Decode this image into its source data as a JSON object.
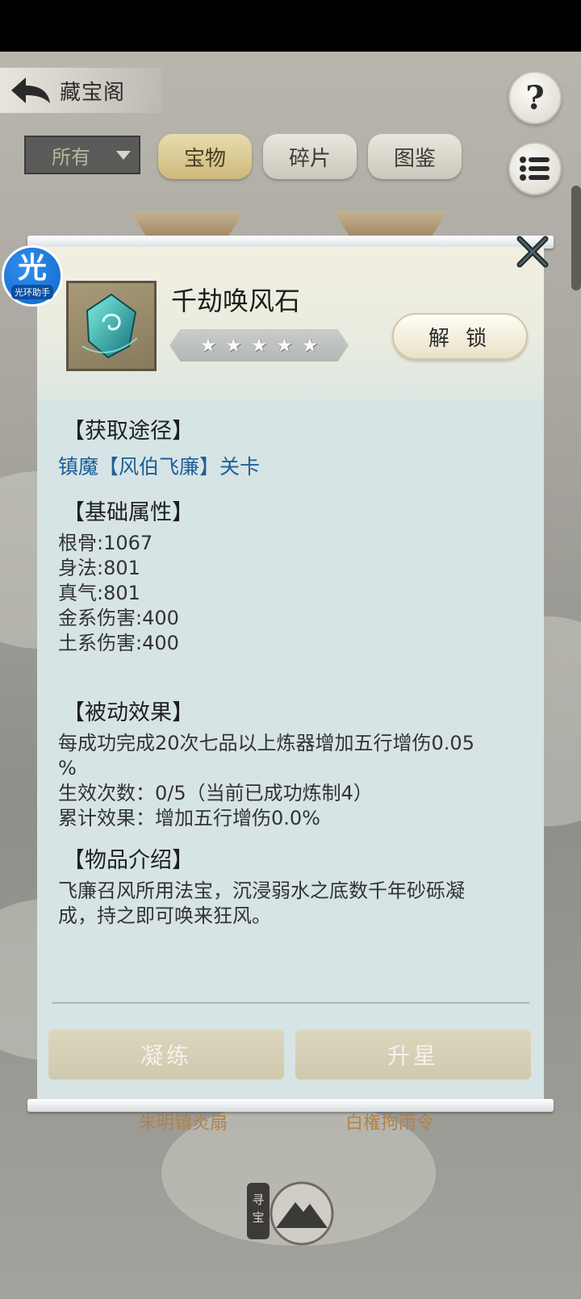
{
  "header": {
    "title": "藏宝阁",
    "help_label": "?"
  },
  "filter": {
    "selected": "所有",
    "tabs": [
      "宝物",
      "碎片",
      "图鉴"
    ]
  },
  "background_labels": [
    "朱明镇炎扇",
    "白権拘雨令"
  ],
  "emblem_label": "寻宝",
  "assistant": {
    "glyph": "光",
    "label": "光环助手"
  },
  "item": {
    "name": "千劫唤风石",
    "stars_total": 5,
    "stars_filled": 0,
    "unlock_label": "解 锁"
  },
  "sections": {
    "source": {
      "title": "【获取途径】",
      "link": "镇魔【风伯飞廉】关卡"
    },
    "base": {
      "title": "【基础属性】",
      "attrs": [
        "根骨:1067",
        "身法:801",
        "真气:801",
        "金系伤害:400",
        "土系伤害:400"
      ]
    },
    "passive": {
      "title": "【被动效果】",
      "lines": [
        "每成功完成20次七品以上炼器增加五行增伤0.05",
        "%",
        "生效次数：0/5（当前已成功炼制4）",
        "累计效果：增加五行增伤0.0%"
      ]
    },
    "intro": {
      "title": "【物品介绍】",
      "lines": [
        "飞廉召风所用法宝，沉浸弱水之底数千年砂砾凝",
        "成，持之即可唤来狂风。"
      ]
    }
  },
  "actions": {
    "refine": "凝练",
    "star_up": "升星"
  },
  "colors": {
    "link": "#1e5f99",
    "tab_active": "#cdb97a",
    "modal_bg": "#d7e4e5"
  }
}
